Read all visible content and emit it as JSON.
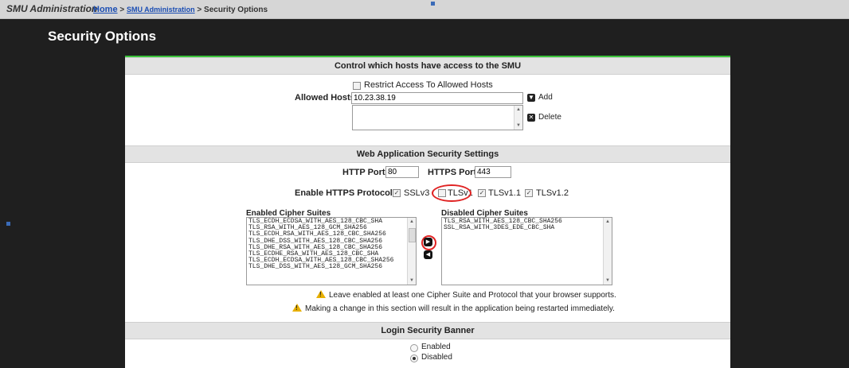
{
  "topbar": {
    "app_title": "SMU Administration",
    "crumb_home": "Home",
    "sep1": ">",
    "crumb_admin": "SMU Administration",
    "sep2": ">",
    "crumb_current": "Security Options"
  },
  "page": {
    "title": "Security Options"
  },
  "access": {
    "header": "Control which hosts have access to the SMU",
    "restrict_label": "Restrict Access To Allowed Hosts",
    "restrict_checked": false,
    "allowed_hosts_label": "Allowed Hosts:",
    "allowed_hosts_value": "10.23.38.19",
    "add_label": "Add",
    "delete_label": "Delete",
    "hosts_list": []
  },
  "web": {
    "header": "Web Application Security Settings",
    "http_port_label": "HTTP Port:",
    "http_port_value": "80",
    "https_port_label": "HTTPS Port:",
    "https_port_value": "443",
    "protocols_label": "Enable HTTPS Protocols:",
    "protocols": [
      {
        "name": "SSLv3",
        "checked": true
      },
      {
        "name": "TLSv1",
        "checked": false
      },
      {
        "name": "TLSv1.1",
        "checked": true
      },
      {
        "name": "TLSv1.2",
        "checked": true
      }
    ],
    "enabled_title": "Enabled Cipher Suites",
    "enabled_suites": [
      "TLS_ECDH_ECDSA_WITH_AES_128_CBC_SHA",
      "TLS_RSA_WITH_AES_128_GCM_SHA256",
      "TLS_ECDH_RSA_WITH_AES_128_CBC_SHA256",
      "TLS_DHE_DSS_WITH_AES_128_CBC_SHA256",
      "TLS_DHE_RSA_WITH_AES_128_CBC_SHA256",
      "TLS_ECDHE_RSA_WITH_AES_128_CBC_SHA",
      "TLS_ECDH_ECDSA_WITH_AES_128_CBC_SHA256",
      "TLS_DHE_DSS_WITH_AES_128_GCM_SHA256"
    ],
    "disabled_title": "Disabled Cipher Suites",
    "disabled_suites": [
      "TLS_RSA_WITH_AES_128_CBC_SHA256",
      "SSL_RSA_WITH_3DES_EDE_CBC_SHA"
    ],
    "warning1": "Leave enabled at least one Cipher Suite and Protocol that your browser supports.",
    "warning2": "Making a change in this section will result in the application being restarted immediately."
  },
  "banner": {
    "header": "Login Security Banner",
    "enabled_label": "Enabled",
    "disabled_label": "Disabled",
    "selected": "Disabled"
  },
  "colors": {
    "accent_green": "#3ac23a",
    "highlight_red": "#e02222",
    "link_blue": "#1a4db3",
    "warning_yellow": "#e8b000"
  }
}
